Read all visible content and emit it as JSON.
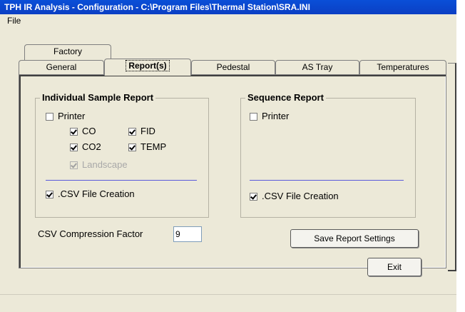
{
  "window": {
    "title": "TPH IR Analysis - Configuration - C:\\Program Files\\Thermal Station\\SRA.INI"
  },
  "menu": {
    "file": "File"
  },
  "tabs": {
    "back_row": [
      {
        "label": "Factory"
      }
    ],
    "front_row": [
      {
        "label": "General"
      },
      {
        "label": "Report(s)",
        "selected": true
      },
      {
        "label": "Pedestal"
      },
      {
        "label": "AS Tray"
      },
      {
        "label": "Temperatures"
      }
    ]
  },
  "individual": {
    "title": "Individual Sample Report",
    "printer": {
      "label": "Printer",
      "checked": false
    },
    "co": {
      "label": "CO",
      "checked": true
    },
    "fid": {
      "label": "FID",
      "checked": true
    },
    "co2": {
      "label": "CO2",
      "checked": true
    },
    "temp": {
      "label": "TEMP",
      "checked": true
    },
    "landscape": {
      "label": "Landscape",
      "checked": true,
      "enabled": false
    },
    "csv": {
      "label": ".CSV File Creation",
      "checked": true
    }
  },
  "sequence": {
    "title": "Sequence Report",
    "printer": {
      "label": "Printer",
      "checked": false
    },
    "csv": {
      "label": ".CSV File Creation",
      "checked": true
    }
  },
  "compression": {
    "label": "CSV Compression Factor",
    "value": "9"
  },
  "buttons": {
    "save": "Save Report Settings",
    "exit": "Exit"
  }
}
